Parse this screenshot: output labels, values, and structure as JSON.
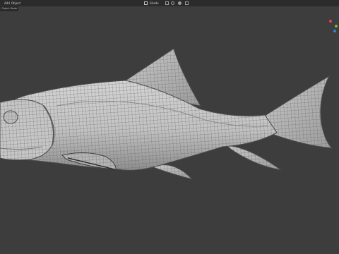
{
  "header": {
    "menu": [
      "Add",
      "Object"
    ],
    "mode": "Object Mode",
    "shading_label": "Shade"
  },
  "gizmo": {
    "x_color": "#e0474f",
    "y_color": "#6bbf3a",
    "z_color": "#3f7fd6"
  },
  "viewport": {
    "background": "#3d3d3d",
    "object": "fish-mesh"
  }
}
